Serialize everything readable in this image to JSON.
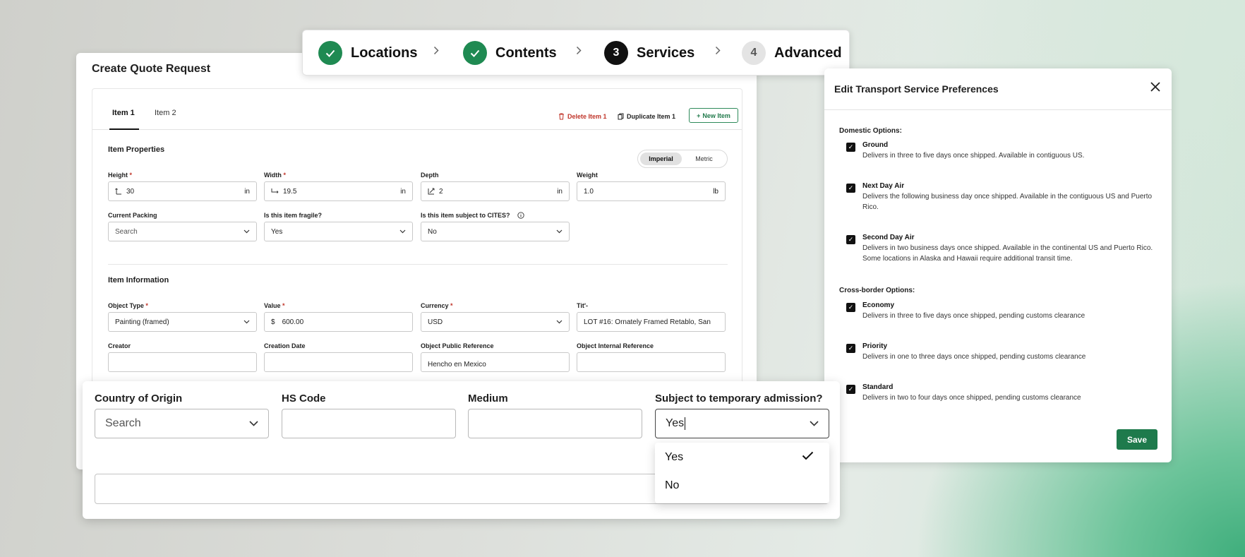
{
  "stepper": {
    "steps": [
      {
        "number": "",
        "label": "Locations",
        "state": "done"
      },
      {
        "number": "",
        "label": "Contents",
        "state": "done"
      },
      {
        "number": "3",
        "label": "Services",
        "state": "current"
      },
      {
        "number": "4",
        "label": "Advanced",
        "state": "todo"
      }
    ]
  },
  "quote": {
    "title": "Create Quote Request",
    "tabs": [
      "Item 1",
      "Item 2"
    ],
    "delete_label": "Delete Item 1",
    "duplicate_label": "Duplicate Item 1",
    "new_label": "New Item",
    "properties_title": "Item Properties",
    "units": {
      "imperial": "Imperial",
      "metric": "Metric",
      "selected": "Imperial"
    },
    "fields": {
      "height": {
        "label": "Height",
        "value": "30",
        "unit": "in"
      },
      "width": {
        "label": "Width",
        "value": "19.5",
        "unit": "in"
      },
      "depth": {
        "label": "Depth",
        "value": "2",
        "unit": "in"
      },
      "weight": {
        "label": "Weight",
        "value": "1.0",
        "unit": "lb"
      },
      "packing": {
        "label": "Current Packing",
        "placeholder": "Search"
      },
      "fragile": {
        "label": "Is this item fragile?",
        "value": "Yes"
      },
      "cites": {
        "label": "Is this item subject to CITES?",
        "value": "No"
      }
    },
    "information_title": "Item Information",
    "info_fields": {
      "object_type": {
        "label": "Object Type",
        "value": "Painting (framed)"
      },
      "value": {
        "label": "Value",
        "prefix": "$",
        "value": "600.00"
      },
      "currency": {
        "label": "Currency",
        "value": "USD"
      },
      "title": {
        "label": "Tit'-",
        "value": "LOT #16: Ornately Framed Retablo, San"
      },
      "creator": {
        "label": "Creator",
        "value": ""
      },
      "creation_date": {
        "label": "Creation Date",
        "value": ""
      },
      "public_ref": {
        "label": "Object Public Reference",
        "value": "Hencho en Mexico"
      },
      "internal_ref": {
        "label": "Object Internal Reference",
        "value": ""
      }
    }
  },
  "zoom": {
    "country": {
      "label": "Country of Origin",
      "placeholder": "Search"
    },
    "hs_code": {
      "label": "HS Code",
      "value": ""
    },
    "medium": {
      "label": "Medium",
      "value": ""
    },
    "temporary": {
      "label": "Subject to temporary admission?",
      "value": "Yes"
    },
    "dropdown_options": [
      "Yes",
      "No"
    ],
    "selected_option": "Yes"
  },
  "transport": {
    "title": "Edit Transport Service Preferences",
    "domestic_title": "Domestic Options:",
    "domestic": [
      {
        "name": "Ground",
        "desc": "Delivers in three to five days once shipped. Available in contiguous US.",
        "checked": true
      },
      {
        "name": "Next Day Air",
        "desc": "Delivers the following business day once shipped. Available in the contiguous US and Puerto Rico.",
        "checked": true
      },
      {
        "name": "Second Day Air",
        "desc": "Delivers in two business days once shipped. Available in the continental US and Puerto Rico. Some locations in Alaska and Hawaii require additional transit time.",
        "checked": true
      }
    ],
    "crossborder_title": "Cross-border Options:",
    "crossborder": [
      {
        "name": "Economy",
        "desc": "Delivers in three to five days once shipped, pending customs clearance",
        "checked": true
      },
      {
        "name": "Priority",
        "desc": "Delivers in one to three days once shipped, pending customs clearance",
        "checked": true
      },
      {
        "name": "Standard",
        "desc": "Delivers in two to four days once shipped, pending customs clearance",
        "checked": true
      }
    ],
    "save_label": "Save"
  },
  "colors": {
    "brand_green": "#1e7a4c",
    "danger": "#c0352a",
    "current_step": "#111111"
  },
  "icons": [
    "check-icon",
    "chevron-right-icon",
    "trash-icon",
    "copy-icon",
    "plus-icon",
    "height-icon",
    "width-icon",
    "depth-icon",
    "chevron-down-icon",
    "info-icon",
    "close-icon"
  ]
}
